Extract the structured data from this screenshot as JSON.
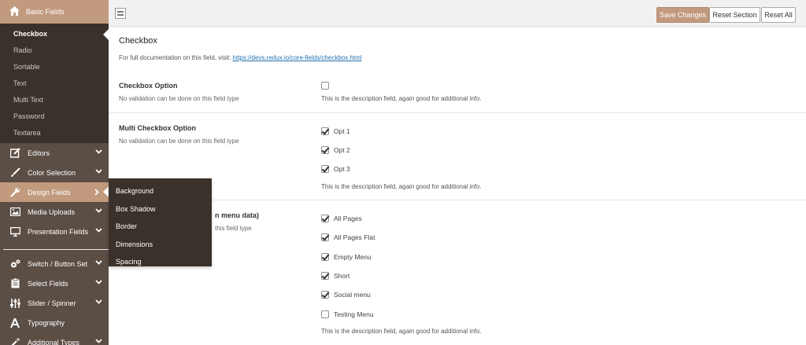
{
  "sidebar": {
    "top_item": {
      "label": "Basic Fields",
      "icon": "home-icon"
    },
    "sub_items": [
      {
        "label": "Checkbox",
        "active": true
      },
      {
        "label": "Radio"
      },
      {
        "label": "Sortable"
      },
      {
        "label": "Text"
      },
      {
        "label": "Multi Text"
      },
      {
        "label": "Password"
      },
      {
        "label": "Textarea"
      }
    ],
    "items": [
      {
        "label": "Editors",
        "icon": "edit-icon"
      },
      {
        "label": "Color Selection",
        "icon": "brush-icon"
      },
      {
        "label": "Design Fields",
        "icon": "wrench-icon"
      },
      {
        "label": "Media Uploads",
        "icon": "image-icon"
      },
      {
        "label": "Presentation Fields",
        "icon": "monitor-icon"
      },
      {
        "label": "Switch / Button Set",
        "icon": "gears-icon"
      },
      {
        "label": "Select Fields",
        "icon": "clipboard-icon"
      },
      {
        "label": "Slider / Spinner",
        "icon": "sliders-icon"
      },
      {
        "label": "Typography",
        "icon": "font-icon"
      },
      {
        "label": "Additional Types",
        "icon": "magic-wand-icon"
      }
    ]
  },
  "flyout": {
    "items": [
      "Background",
      "Box Shadow",
      "Border",
      "Dimensions",
      "Spacing"
    ]
  },
  "toolbar": {
    "save_label": "Save Changes",
    "reset_section_label": "Reset Section",
    "reset_all_label": "Reset All"
  },
  "colors": {
    "accent": "#c29a7e",
    "sidebar_bg": "#5a4e45",
    "submenu_bg": "#3a312b"
  },
  "main": {
    "title": "Checkbox",
    "doc_prefix": "For full documentation on this field, visit: ",
    "doc_link": "https://devs.redux.io/core-fields/checkbox.html",
    "fields": [
      {
        "title": "Checkbox Option",
        "subtitle": "No validation can be done on this field type",
        "options": [
          {
            "label": "",
            "checked": false
          }
        ],
        "description": "This is the description field, again good for additional info."
      },
      {
        "title": "Multi Checkbox Option",
        "subtitle": "No validation can be done on this field type",
        "options": [
          {
            "label": "Opt 1",
            "checked": true
          },
          {
            "label": "Opt 2",
            "checked": true
          },
          {
            "label": "Opt 3",
            "checked": true
          }
        ],
        "description": "This is the description field, again good for additional info."
      },
      {
        "title": "n menu data)",
        "subtitle": "this field type",
        "options": [
          {
            "label": "All Pages",
            "checked": true
          },
          {
            "label": "All Pages Flat",
            "checked": true
          },
          {
            "label": "Empty Menu",
            "checked": true
          },
          {
            "label": "Short",
            "checked": true
          },
          {
            "label": "Social menu",
            "checked": true
          },
          {
            "label": "Testing Menu",
            "checked": false
          }
        ],
        "description": "This is the description field, again good for additional info."
      }
    ]
  }
}
